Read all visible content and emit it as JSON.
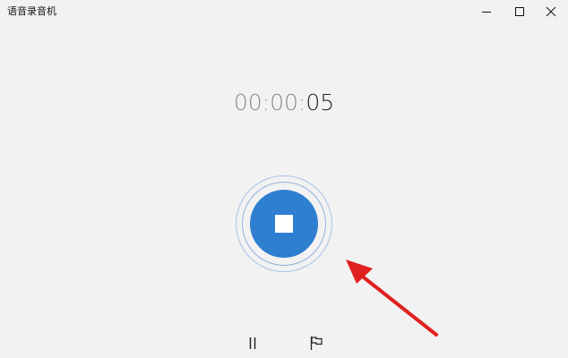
{
  "window": {
    "title": "语音录音机"
  },
  "timer": {
    "dim_part": "00:00:",
    "bright_part": "05"
  },
  "icons": {
    "minimize": "minimize-icon",
    "maximize": "maximize-icon",
    "close": "close-icon",
    "stop": "stop-icon",
    "pause": "pause-icon",
    "flag": "flag-icon",
    "arrow": "red-arrow-annotation"
  },
  "colors": {
    "background": "#f2f2f2",
    "accent": "#2f7fd1",
    "ring": "#8fb2e0",
    "annotation": "#e02020"
  }
}
